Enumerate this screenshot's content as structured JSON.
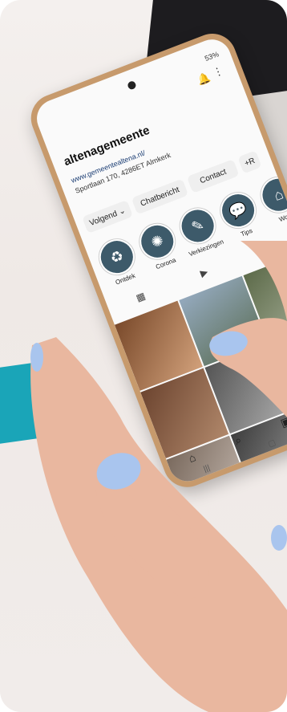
{
  "status_bar": {
    "text": "53%"
  },
  "profile": {
    "account_name": "altenagemeente",
    "link": "www.gemeentealtena.nl/",
    "address": "Sportlaan 170, 4286ET Almkerk"
  },
  "buttons": {
    "follow": "Volgend",
    "message": "Chatbericht",
    "contact": "Contact",
    "add": "+R"
  },
  "highlights": [
    {
      "label": "Ontdek",
      "icon": "recycle-icon"
    },
    {
      "label": "Corona",
      "icon": "sun-icon"
    },
    {
      "label": "Verkiezingen",
      "icon": "pencil-icon"
    },
    {
      "label": "Tips",
      "icon": "chat-bubbles-icon"
    },
    {
      "label": "Woon",
      "icon": "house-icon"
    }
  ],
  "colors": {
    "phone_case": "#c79a6c",
    "nail_polish": "#a9c5ee",
    "highlight_circle": "#3d5a6a"
  }
}
